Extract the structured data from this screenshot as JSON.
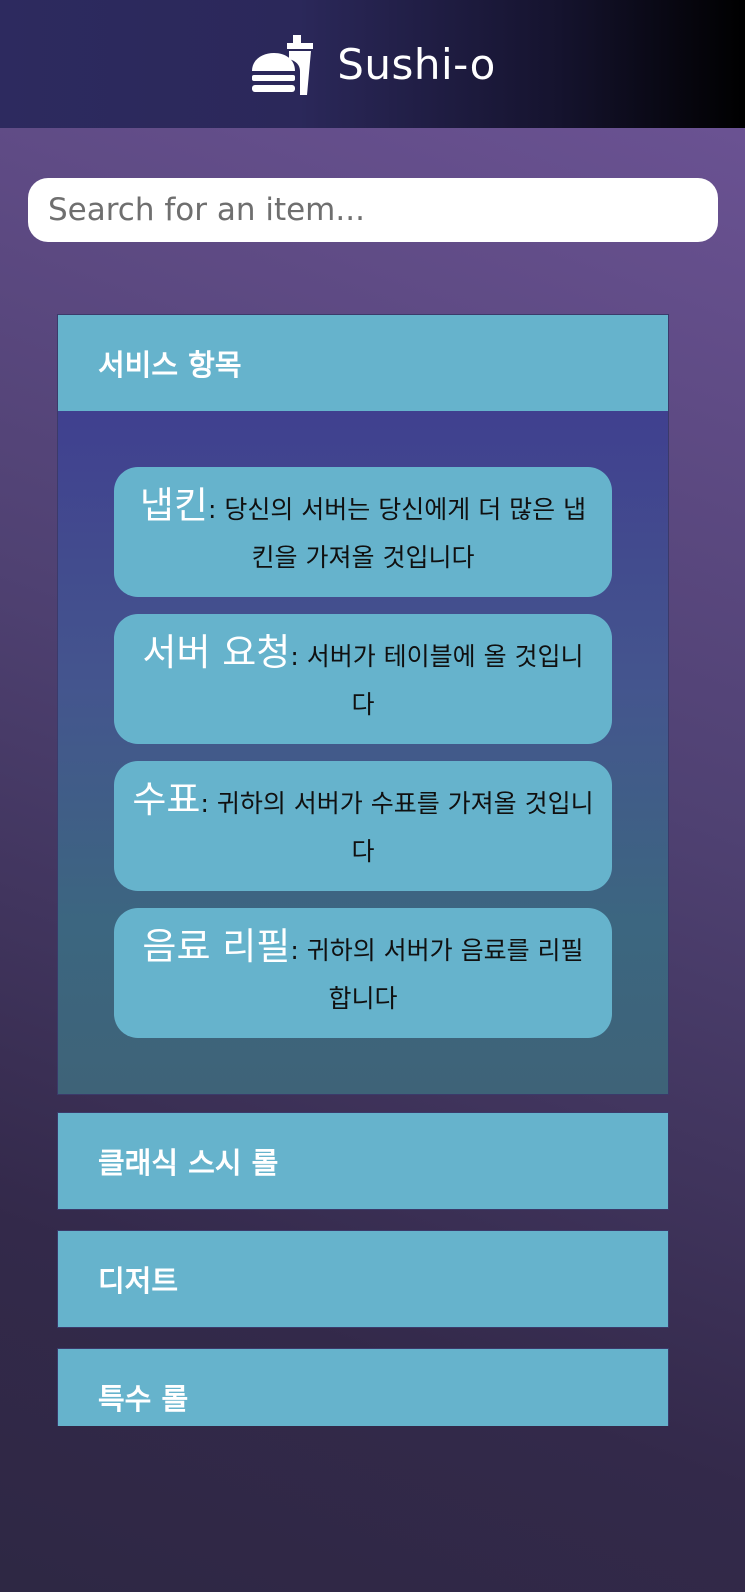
{
  "header": {
    "brand": "Sushi-o",
    "logo_icon": "fast-food-icon"
  },
  "search": {
    "placeholder": "Search for an item..."
  },
  "sections": [
    {
      "title": "서비스 항목",
      "expanded": true,
      "items": [
        {
          "name": "냅킨",
          "desc": ": 당신의 서버는 당신에게 더 많은 냅킨을 가져올 것입니다"
        },
        {
          "name": "서버 요청",
          "desc": ": 서버가 테이블에 올 것입니다"
        },
        {
          "name": "수표",
          "desc": ": 귀하의 서버가 수표를 가져올 것입니다"
        },
        {
          "name": "음료 리필",
          "desc": ": 귀하의 서버가 음료를 리필합니다"
        }
      ]
    },
    {
      "title": "클래식 스시 롤",
      "expanded": false
    },
    {
      "title": "디저트",
      "expanded": false
    },
    {
      "title": "특수 롤",
      "expanded": false
    }
  ],
  "colors": {
    "accent": "#66b3cc",
    "header_start": "#2d2a5f",
    "header_end": "#000000"
  }
}
